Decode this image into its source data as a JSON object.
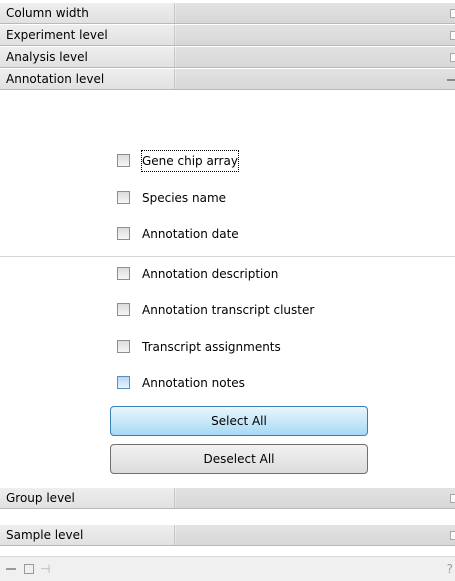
{
  "sections": {
    "column_width": {
      "label": "Column width",
      "state": "collapsed"
    },
    "experiment_level": {
      "label": "Experiment level",
      "state": "collapsed"
    },
    "analysis_level": {
      "label": "Analysis level",
      "state": "collapsed"
    },
    "annotation_level": {
      "label": "Annotation level",
      "state": "expanded"
    },
    "group_level": {
      "label": "Group level",
      "state": "collapsed"
    },
    "sample_level": {
      "label": "Sample level",
      "state": "collapsed"
    }
  },
  "annotation_options": [
    {
      "label": "Gene chip array",
      "checked": false,
      "focused": true
    },
    {
      "label": "Species name",
      "checked": false
    },
    {
      "label": "Annotation date",
      "checked": false
    },
    {
      "label": "Annotation description",
      "checked": false
    },
    {
      "label": "Annotation transcript cluster",
      "checked": false
    },
    {
      "label": "Transcript assignments",
      "checked": false
    },
    {
      "label": "Annotation notes",
      "checked": false,
      "hovered": true
    }
  ],
  "buttons": {
    "select_all": "Select All",
    "deselect_all": "Deselect All"
  },
  "statusbar": {
    "help": "?"
  },
  "colors": {
    "header_bg": "#e6e6e6",
    "primary_button": "#a7d9f5",
    "highlight_checkbox": "#b9d7f2"
  }
}
